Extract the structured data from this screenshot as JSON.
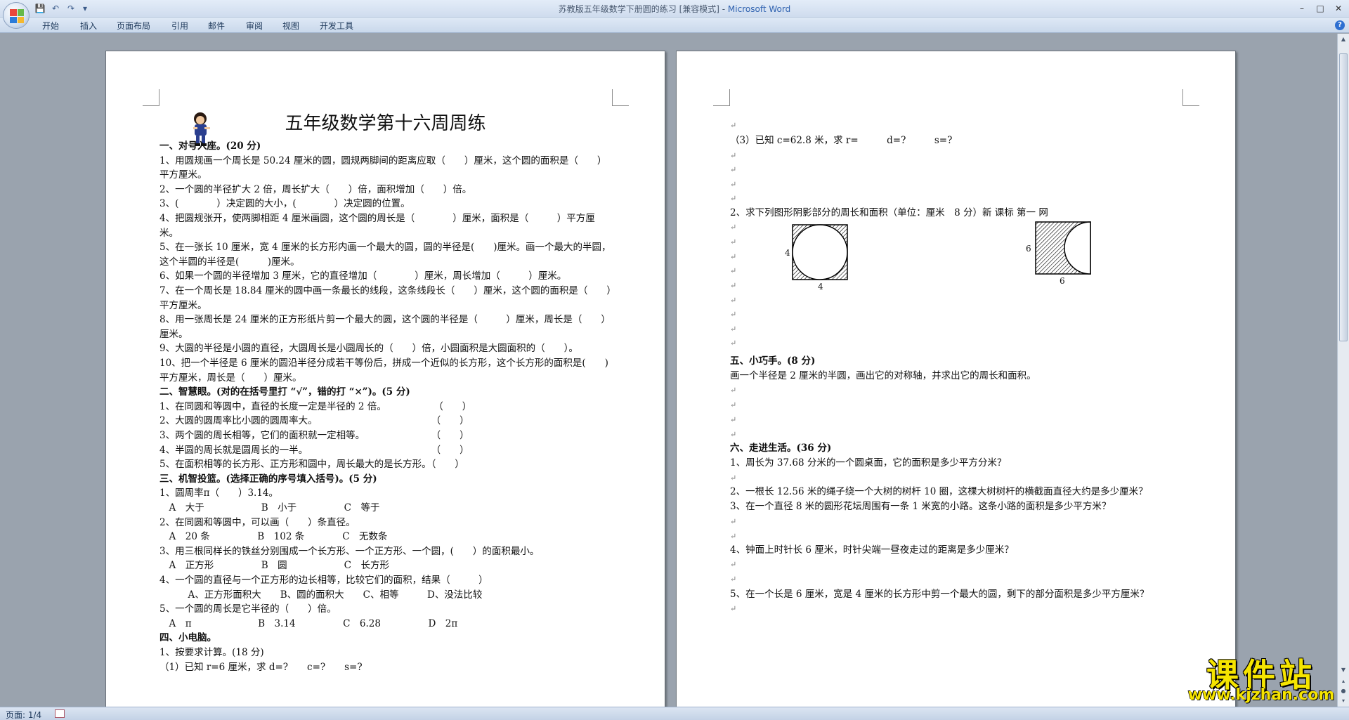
{
  "window": {
    "title": "苏教版五年级数学下册圆的练习 [兼容模式] - ",
    "app_name": "Microsoft Word",
    "controls": {
      "minimize": "–",
      "maximize": "□",
      "close": "✕"
    }
  },
  "qat": {
    "save": "💾",
    "undo": "↶",
    "redo": "↷",
    "more": "▾"
  },
  "ribbon": {
    "tabs": [
      "开始",
      "插入",
      "页面布局",
      "引用",
      "邮件",
      "审阅",
      "视图",
      "开发工具"
    ],
    "help": "?"
  },
  "status": {
    "page": "页面: 1/4"
  },
  "page1": {
    "title": "五年级数学第十六周周练",
    "lines": [
      "一、对号入座。(20 分)",
      "1、用圆规画一个周长是 50.24 厘米的圆，圆规两脚间的距离应取（　　）厘米，这个圆的面积是（　　）",
      "平方厘米。",
      "2、一个圆的半径扩大 2 倍，周长扩大（　　）倍，面积增加（　　）倍。",
      "3、(　　　　）决定圆的大小，(　　　　）决定圆的位置。",
      "4、把圆规张开，使两脚相距 4 厘米画圆，这个圆的周长是（　　　　）厘米，面积是（　　　）平方厘",
      "米。",
      "5、在一张长 10 厘米，宽 4 厘米的长方形内画一个最大的圆，圆的半径是(　　)厘米。画一个最大的半圆，",
      "这个半圆的半径是(　　　)厘米。",
      "6、如果一个圆的半径增加 3 厘米，它的直径增加（　　　　）厘米，周长增加（　　　）厘米。",
      "7、在一个周长是 18.84 厘米的圆中画一条最长的线段，这条线段长（　　）厘米，这个圆的面积是（　　）",
      "平方厘米。",
      "8、用一张周长是 24 厘米的正方形纸片剪一个最大的圆，这个圆的半径是（　　　）厘米，周长是（　　）",
      "厘米。",
      "9、大圆的半径是小圆的直径，大圆周长是小圆周长的（　　）倍，小圆面积是大圆面积的（　　）。",
      "10、把一个半径是 6 厘米的圆沿半径分成若干等份后，拼成一个近似的长方形，这个长方形的面积是(　　)",
      "平方厘米，周长是（　　）厘米。",
      "二、智慧眼。(对的在括号里打 “√”，错的打 “×”)。(5 分)",
      "1、在同圆和等圆中，直径的长度一定是半径的 2 倍。　　　　　　（　　）",
      "2、大圆的圆周率比小圆的圆周率大。　　　　　　　　　　　　　（　　）",
      "3、两个圆的周长相等，它们的面积就一定相等。　　　　　　　　（　　）",
      "4、半圆的周长就是圆周长的一半。　　　　　　　　　　　　　　（　　）",
      "5、在面积相等的长方形、正方形和圆中，周长最大的是长方形。（　　）",
      "三、机智投篮。(选择正确的序号填入括号)。(5 分)",
      "1、圆周率π（　　）3.14。",
      "　A　大于　　　　　　B　小于　　　　　C　等于",
      "2、在同圆和等圆中，可以画（　　）条直径。",
      "　A　20 条　　　　　B　102 条　　　　C　无数条",
      "3、用三根同样长的铁丝分别围成一个长方形、一个正方形、一个圆，(　　）的面积最小。",
      "　A　正方形　　　　　B　圆　　　　　　C　长方形",
      "4、一个圆的直径与一个正方形的边长相等，比较它们的面积，结果（　　　）",
      "　　　A、正方形面积大　　B、圆的面积大　　C、相等　　　D、没法比较",
      "5、一个圆的周长是它半径的（　　）倍。",
      "　A　π　　　　　　　B　3.14　　　　　C　6.28　　　　　D　2π",
      "四、小电脑。",
      "1、按要求计算。(18 分)",
      "（1）已知 r=6 厘米，求 d=?　　c=?　　s=?"
    ]
  },
  "page2": {
    "lines_top": [
      "（3）已知 c=62.8 米，求 r=　　　d=?　　　s=?",
      "2、求下列图形阴影部分的周长和面积（单位：厘米　8 分）新 课标 第一 网"
    ],
    "figure1": {
      "side_label": "4",
      "bottom_label": "4"
    },
    "figure2": {
      "side_label": "6",
      "bottom_label": "6"
    },
    "lines_bottom": [
      "五、小巧手。(8 分)",
      "画一个半径是 2 厘米的半圆，画出它的对称轴，并求出它的周长和面积。",
      "六、走进生活。(36 分)",
      "1、周长为 37.68 分米的一个圆桌面，它的面积是多少平方分米？",
      "2、一根长 12.56 米的绳子绕一个大树的树杆 10 圈，这棵大树树杆的横截面直径大约是多少厘米？",
      "3、在一个直径 8 米的圆形花坛周围有一条 1 米宽的小路。这条小路的面积是多少平方米？",
      "4、钟面上时针长 6 厘米，时针尖端一昼夜走过的距离是多少厘米？",
      "5、在一个长是 6 厘米，宽是 4 厘米的长方形中剪一个最大的圆，剩下的部分面积是多少平方厘米？"
    ],
    "para_mark": "↵"
  },
  "watermark": {
    "text": "课件站",
    "url": "www.kjzhan.com"
  },
  "colors": {
    "ribbon_text": "#1e395b",
    "app_name": "#2f62b0",
    "watermark": "#f5e400",
    "workspace": "#9aa3ae"
  }
}
